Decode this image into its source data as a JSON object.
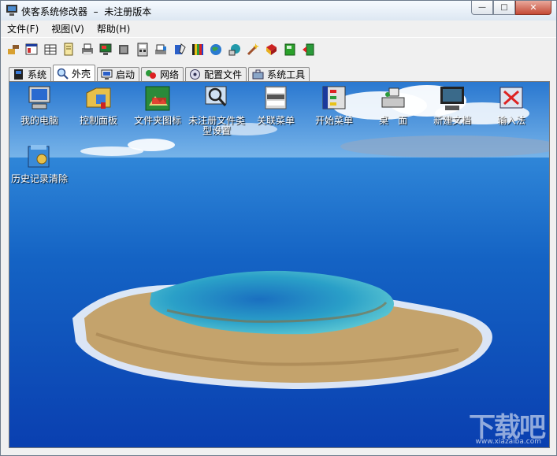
{
  "window": {
    "title": "侠客系统修改器  –  未注册版本",
    "minimize_label": "—",
    "maximize_label": "□",
    "close_label": "✕"
  },
  "menu": [
    {
      "label": "文件(F)"
    },
    {
      "label": "视图(V)"
    },
    {
      "label": "帮助(H)"
    }
  ],
  "toolbar": {
    "icons": [
      "tool-icon",
      "window-icon",
      "table-icon",
      "document-icon",
      "printer-icon",
      "monitor-icon",
      "chip-icon",
      "calculator-icon",
      "scanner-icon",
      "pen-icon",
      "colors-icon",
      "globe-icon",
      "network-icon",
      "wand-icon",
      "book-icon",
      "notebook-icon",
      "exit-icon"
    ]
  },
  "tabs": [
    {
      "label": "系统",
      "icon": "system-icon",
      "active": false
    },
    {
      "label": "外壳",
      "icon": "search-icon",
      "active": true
    },
    {
      "label": "启动",
      "icon": "startup-icon",
      "active": false
    },
    {
      "label": "网络",
      "icon": "network-icon",
      "active": false
    },
    {
      "label": "配置文件",
      "icon": "config-icon",
      "active": false
    },
    {
      "label": "系统工具",
      "icon": "toolbox-icon",
      "active": false
    }
  ],
  "desktop_icons": [
    {
      "label": "我的电脑",
      "icon": "computer-icon"
    },
    {
      "label": "控制面板",
      "icon": "control-panel-icon"
    },
    {
      "label": "文件夹图标",
      "icon": "folder-image-icon"
    },
    {
      "label": "未注册文件类型设置",
      "icon": "unregistered-filetype-icon"
    },
    {
      "label": "关联菜单",
      "icon": "open-menu-icon"
    },
    {
      "label": "开始菜单",
      "icon": "start-menu-icon"
    },
    {
      "label": "桌　面",
      "icon": "desktop-icon"
    },
    {
      "label": "新建文档",
      "icon": "new-document-icon"
    },
    {
      "label": "输入法",
      "icon": "input-method-icon"
    },
    {
      "label": "历史记录清除",
      "icon": "history-clear-icon"
    }
  ],
  "watermark": {
    "text": "下载吧",
    "sub": "www.xiazaiba.com"
  },
  "colors": {
    "sea_deep": "#0a3fb0",
    "sea_light": "#2f86d8",
    "sky": "#3e93e0",
    "lagoon": "#28a6c9",
    "land": "#c4a36c"
  }
}
